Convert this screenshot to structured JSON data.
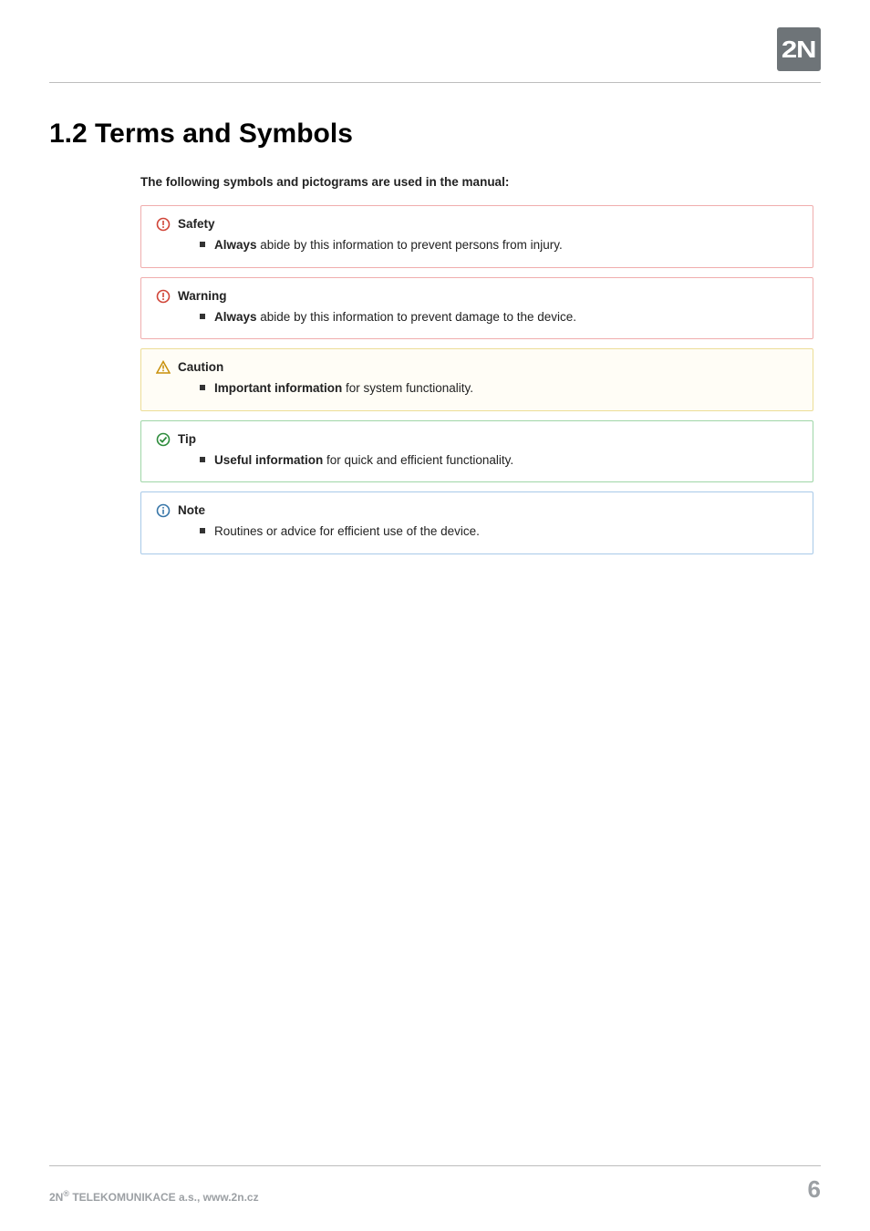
{
  "logo": "2N",
  "heading": "1.2 Terms and Symbols",
  "intro": "The following symbols and pictograms are used in the manual:",
  "safety": {
    "title": "Safety",
    "bullet_bold": "Always",
    "bullet_rest": "  abide by this information to prevent persons from injury."
  },
  "warning": {
    "title": "Warning",
    "bullet_bold": "Always",
    "bullet_rest": " abide by this information to prevent damage to the device."
  },
  "caution": {
    "title": "Caution",
    "bullet_bold": "Important information",
    "bullet_rest": " for system functionality."
  },
  "tip": {
    "title": "Tip",
    "bullet_bold": "Useful information",
    "bullet_rest": " for quick and efficient functionality."
  },
  "note": {
    "title": "Note",
    "bullet_bold": "",
    "bullet_rest": "Routines or advice for efficient use of the device."
  },
  "footer_left_pre": "2N",
  "footer_left_sup": "®",
  "footer_left_post": " TELEKOMUNIKACE a.s., www.2n.cz",
  "page_number": "6"
}
